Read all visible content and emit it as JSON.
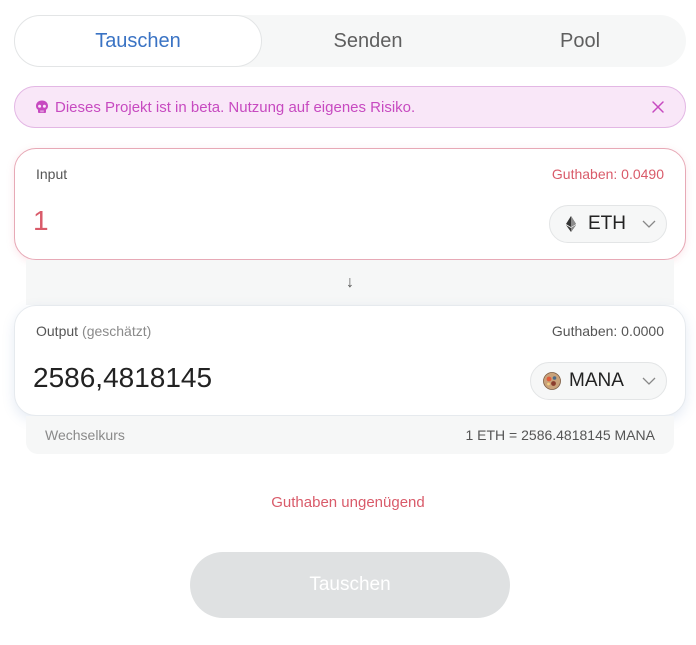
{
  "tabs": [
    {
      "label": "Tauschen",
      "active": true
    },
    {
      "label": "Senden",
      "active": false
    },
    {
      "label": "Pool",
      "active": false
    }
  ],
  "banner": {
    "icon": "skull-icon",
    "text": "Dieses Projekt ist in beta. Nutzung auf eigenes Risiko.",
    "close_icon": "close-icon"
  },
  "input_panel": {
    "label": "Input",
    "balance": "Guthaben: 0.0490",
    "amount": "1",
    "token": {
      "symbol": "ETH",
      "icon": "ethereum-icon"
    }
  },
  "switch_arrow": "↓",
  "output_panel": {
    "label": "Output",
    "label_sub": "(geschätzt)",
    "balance": "Guthaben: 0.0000",
    "amount": "2586,4818145",
    "token": {
      "symbol": "MANA",
      "icon": "mana-icon"
    }
  },
  "rate": {
    "label": "Wechselkurs",
    "value": "1 ETH = 2586.4818145 MANA"
  },
  "warning": "Guthaben ungenügend",
  "swap_button": {
    "label": "Tauschen",
    "disabled": true
  },
  "colors": {
    "accent": "#3a73c4",
    "error": "#d95b6a",
    "banner_bg": "#f9e7f8",
    "banner_text": "#c74ac0"
  }
}
